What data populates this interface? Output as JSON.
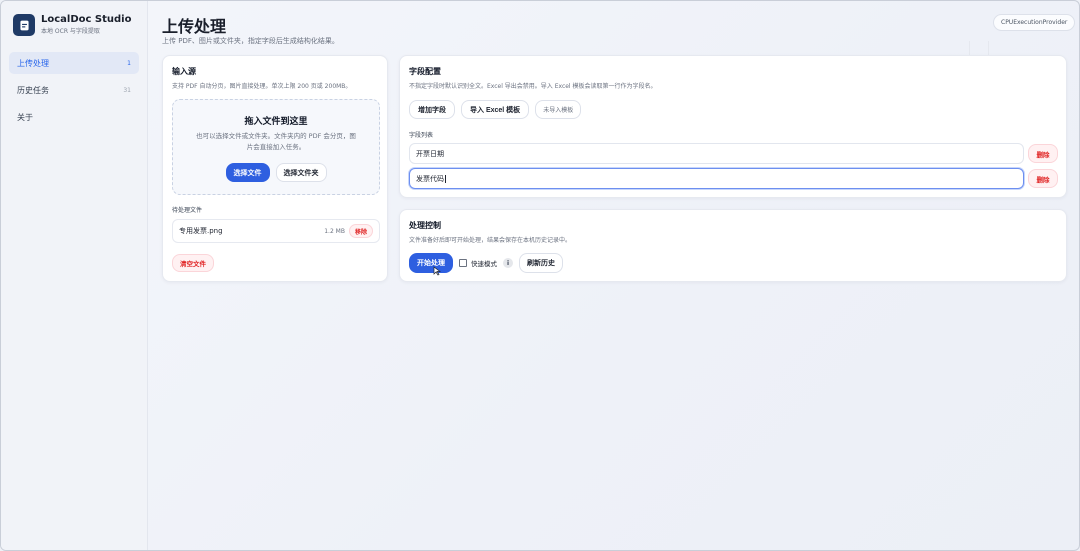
{
  "app": {
    "name": "LocalDoc Studio",
    "subtitle": "本地 OCR 与字段提取"
  },
  "sidebar": {
    "items": [
      {
        "label": "上传处理",
        "count": "1"
      },
      {
        "label": "历史任务",
        "count": "31"
      },
      {
        "label": "关于",
        "count": ""
      }
    ]
  },
  "header": {
    "title": "上传处理",
    "subtitle": "上传 PDF、图片或文件夹，指定字段后生成结构化结果。",
    "provider": "CPUExecutionProvider"
  },
  "input_source": {
    "title": "输入源",
    "desc": "支持 PDF 自动分页，图片直接处理。单次上限 200 页或 200MB。",
    "dropzone": {
      "title": "拖入文件到这里",
      "desc": "也可以选择文件或文件夹。文件夹内的 PDF 会分页，图片会直接加入任务。",
      "select_file": "选择文件",
      "select_folder": "选择文件夹"
    },
    "pending_label": "待处理文件",
    "files": [
      {
        "name": "专用发票.png",
        "size": "1.2 MB",
        "remove": "移除"
      }
    ],
    "clear": "清空文件"
  },
  "field_config": {
    "title": "字段配置",
    "desc": "不指定字段时默认识别全文。Excel 导出会禁用。导入 Excel 模板会读取第一行作为字段名。",
    "add_field": "增加字段",
    "import_excel": "导入 Excel 模板",
    "not_imported": "未导入模板",
    "list_label": "字段列表",
    "fields": [
      {
        "value": "开票日期",
        "delete": "删除"
      },
      {
        "value": "发票代码",
        "delete": "删除"
      }
    ]
  },
  "process": {
    "title": "处理控制",
    "desc": "文件准备好后即可开始处理，结果会保存在本机历史记录中。",
    "start": "开始处理",
    "fast_mode": "快速模式",
    "info": "i",
    "refresh": "刷新历史"
  }
}
